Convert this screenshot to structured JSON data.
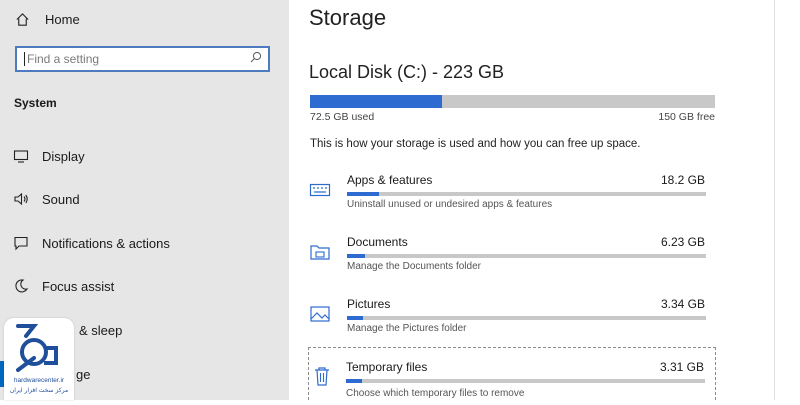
{
  "sidebar": {
    "home_label": "Home",
    "search": {
      "placeholder": "Find a setting"
    },
    "section_title": "System",
    "items": [
      {
        "label": "Display",
        "icon": "monitor-icon"
      },
      {
        "label": "Sound",
        "icon": "speaker-icon"
      },
      {
        "label": "Notifications & actions",
        "icon": "notification-icon"
      },
      {
        "label": "Focus assist",
        "icon": "moon-icon"
      },
      {
        "label": "& sleep",
        "icon": "power-icon"
      },
      {
        "label": "ge",
        "icon": "storage-icon",
        "selected": true
      }
    ]
  },
  "watermark": {
    "site": "hardwarecenter.ir",
    "tagline": "مرکز سخت افزار ایران"
  },
  "main": {
    "title": "Storage",
    "disk": {
      "title": "Local Disk (C:) - 223 GB",
      "used": "72.5 GB used",
      "free": "150 GB free",
      "used_fraction": 0.325
    },
    "description": "This is how your storage is used and how you can free up space.",
    "categories": [
      {
        "name": "Apps & features",
        "size": "18.2 GB",
        "sub": "Uninstall unused or undesired apps & features",
        "fraction": 0.09,
        "icon": "keyboard-icon"
      },
      {
        "name": "Documents",
        "size": "6.23 GB",
        "sub": "Manage the Documents folder",
        "fraction": 0.05,
        "icon": "folder-icon"
      },
      {
        "name": "Pictures",
        "size": "3.34 GB",
        "sub": "Manage the Pictures folder",
        "fraction": 0.045,
        "icon": "picture-icon"
      },
      {
        "name": "Temporary files",
        "size": "3.31 GB",
        "sub": "Choose which temporary files to remove",
        "fraction": 0.045,
        "icon": "trash-icon"
      }
    ]
  },
  "colors": {
    "accent": "#2e6bd1",
    "sidebar_bg": "#e6e6e6",
    "track": "#c8c8c8"
  }
}
